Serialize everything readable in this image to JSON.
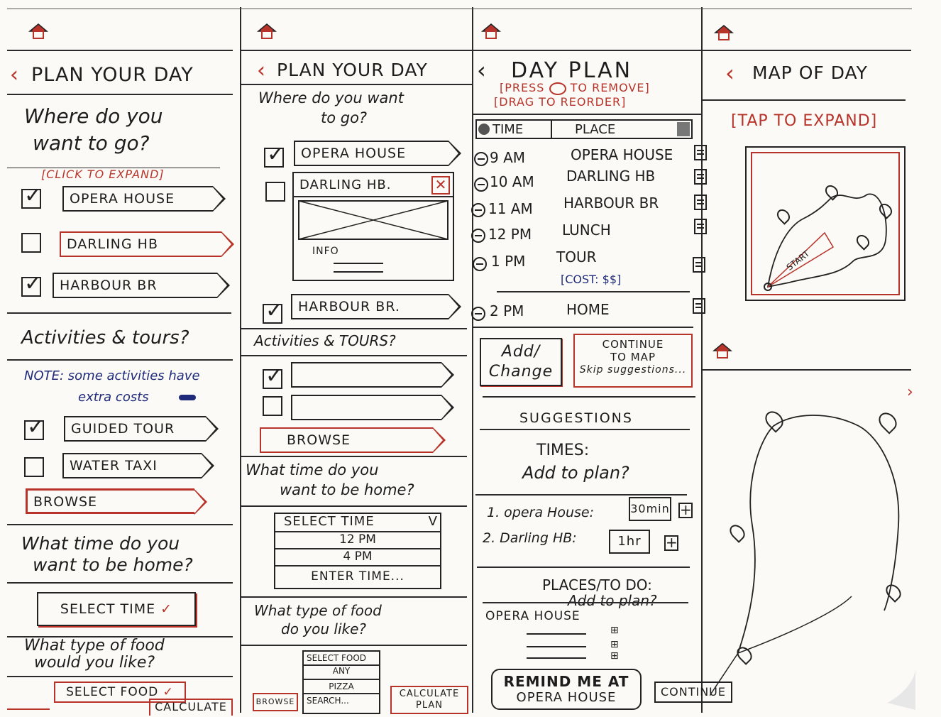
{
  "panel1": {
    "title": "PLAN YOUR DAY",
    "question_where_1": "Where do you",
    "question_where_2": "want to go?",
    "expand_hint": "[CLICK TO EXPAND]",
    "places": [
      {
        "label": "OPERA HOUSE",
        "checked": true
      },
      {
        "label": "DARLING HB",
        "checked": false
      },
      {
        "label": "HARBOUR BR",
        "checked": true
      }
    ],
    "activities_title": "Activities & tours?",
    "note_1": "NOTE: some activities have",
    "note_2": "extra costs",
    "activities": [
      {
        "label": "GUIDED TOUR",
        "checked": true
      },
      {
        "label": "WATER TAXI",
        "checked": false
      }
    ],
    "browse": "BROWSE",
    "time_q_1": "What time do you",
    "time_q_2": "want to be home?",
    "select_time": "SELECT TIME",
    "food_q_1": "What type of food",
    "food_q_2": "would you like?",
    "select_food": "SELECT FOOD",
    "calculate": "CALCULATE"
  },
  "panel2": {
    "title": "PLAN YOUR DAY",
    "question_1": "Where do you want",
    "question_2": "to go?",
    "opera": "OPERA HOUSE",
    "darling": "DARLING HB.",
    "info": "INFO",
    "harbour": "HARBOUR BR.",
    "activities_title": "Activities & TOURS?",
    "browse": "BROWSE",
    "time_q_1": "What time do you",
    "time_q_2": "want to be home?",
    "select_time": "SELECT TIME",
    "time_options": [
      "12 PM",
      "4 PM",
      "ENTER TIME..."
    ],
    "food_q_1": "What type of food",
    "food_q_2": "do you like?",
    "select_food": "SELECT FOOD",
    "food_options": [
      "ANY",
      "PIZZA",
      "SEARCH..."
    ],
    "browse_small": "BROWSE",
    "calculate_1": "CALCULATE",
    "calculate_2": "PLAN"
  },
  "panel3": {
    "title": "DAY PLAN",
    "hint_1": "[PRESS",
    "hint_2": "TO REMOVE]",
    "hint_3": "[DRAG TO REORDER]",
    "col_time": "TIME",
    "col_place": "PLACE",
    "rows": [
      {
        "time": "9 AM",
        "place": "OPERA HOUSE"
      },
      {
        "time": "10 AM",
        "place": "DARLING HB"
      },
      {
        "time": "11 AM",
        "place": "HARBOUR BR"
      },
      {
        "time": "12 PM",
        "place": "LUNCH"
      },
      {
        "time": "1 PM",
        "place": "TOUR"
      },
      {
        "time": "2 PM",
        "place": "HOME"
      }
    ],
    "tour_cost": "[COST: $$]",
    "add_change_1": "Add/",
    "add_change_2": "Change",
    "continue_1": "CONTINUE",
    "continue_2": "TO MAP",
    "continue_3": "Skip suggestions...",
    "suggestions": "SUGGESTIONS",
    "times_1": "TIMES:",
    "times_2": "Add to plan?",
    "sugg_items": [
      {
        "label": "1. opera House:",
        "value": "30min"
      },
      {
        "label": "2. Darling HB:",
        "value": "1hr"
      }
    ],
    "places_todo": "PLACES/TO DO:",
    "add_to_plan": "Add to plan?",
    "opera": "OPERA HOUSE",
    "remind_1": "REMIND ME AT",
    "remind_2": "OPERA HOUSE"
  },
  "panel4": {
    "title": "MAP OF DAY",
    "tap_hint": "[TAP TO EXPAND]",
    "start": "START",
    "continue": "CONTINUE"
  },
  "colors": {
    "ink": "#1d1d1d",
    "red": "#b8342a",
    "blue": "#1f2b7a",
    "paper": "#fbfaf6"
  }
}
